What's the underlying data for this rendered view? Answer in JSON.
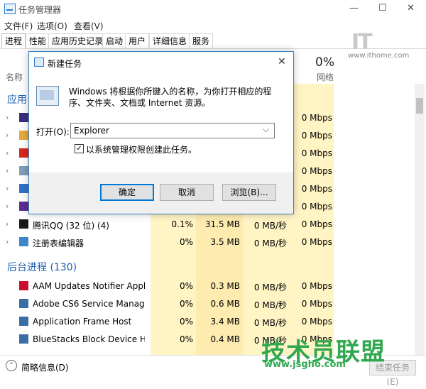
{
  "window": {
    "title": "任务管理器",
    "minimize": "—",
    "maximize": "☐",
    "close": "✕"
  },
  "menu": [
    "文件(F)",
    "选项(O)",
    "查看(V)"
  ],
  "tabs": [
    "进程",
    "性能",
    "应用历史记录",
    "启动",
    "用户",
    "详细信息",
    "服务"
  ],
  "watermark_top": {
    "logo": "IT",
    "site": "www.ithome.com"
  },
  "header": {
    "name_col": "名称",
    "network_pct": "0%",
    "network_label": "网络"
  },
  "groups": {
    "apps": "应用",
    "background": "后台进程 (130)"
  },
  "app_rows": [
    {
      "name": "",
      "cpu": "",
      "mem": "",
      "disk": "",
      "net": "0 Mbps",
      "icon_color": "#3a2f7d"
    },
    {
      "name": "",
      "cpu": "",
      "mem": "",
      "disk": "",
      "net": "0 Mbps",
      "icon_color": "#e8a83a"
    },
    {
      "name": "",
      "cpu": "",
      "mem": "",
      "disk": "",
      "net": "0 Mbps",
      "icon_color": "#d9261c"
    },
    {
      "name": "",
      "cpu": "",
      "mem": "",
      "disk": "",
      "net": "0 Mbps",
      "icon_color": "#7f9db9"
    },
    {
      "name": "",
      "cpu": "",
      "mem": "",
      "disk": "",
      "net": "0 Mbps",
      "icon_color": "#2d73c9"
    },
    {
      "name": "",
      "cpu": "",
      "mem": "",
      "disk": "",
      "net": "0 Mbps",
      "icon_color": "#5b2d91"
    },
    {
      "name": "腾讯QQ (32 位) (4)",
      "cpu": "0.1%",
      "mem": "31.5 MB",
      "disk": "0 MB/秒",
      "net": "0 Mbps",
      "icon_color": "#1a1a1a"
    },
    {
      "name": "注册表编辑器",
      "cpu": "0%",
      "mem": "3.5 MB",
      "disk": "0 MB/秒",
      "net": "0 Mbps",
      "icon_color": "#3e86c9"
    }
  ],
  "bg_rows": [
    {
      "name": "AAM Updates Notifier Appli...",
      "cpu": "0%",
      "mem": "0.3 MB",
      "disk": "0 MB/秒",
      "net": "0 Mbps",
      "icon_color": "#c8102e"
    },
    {
      "name": "Adobe CS6 Service Manager...",
      "cpu": "0%",
      "mem": "0.6 MB",
      "disk": "0 MB/秒",
      "net": "0 Mbps",
      "icon_color": "#3a6ea5"
    },
    {
      "name": "Application Frame Host",
      "cpu": "0%",
      "mem": "3.4 MB",
      "disk": "0 MB/秒",
      "net": "0 Mbps",
      "icon_color": "#3a6ea5"
    },
    {
      "name": "BlueStacks Block Device Hel...",
      "cpu": "0%",
      "mem": "0.4 MB",
      "disk": "0 MB/秒",
      "net": "0 Mbps",
      "icon_color": "#3a6ea5"
    }
  ],
  "footer": {
    "fewer_details": "简略信息(D)",
    "end_task": "结束任务(E)"
  },
  "watermark_bottom": {
    "text": "技术员联盟",
    "site": "www.jsgho.com"
  },
  "dialog": {
    "title": "新建任务",
    "close": "✕",
    "description": "Windows 将根据你所键入的名称，为你打开相应的程序、文件夹、文档或 Internet 资源。",
    "open_label": "打开(O):",
    "open_value": "Explorer",
    "admin_checkbox": "以系统管理权限创建此任务。",
    "ok": "确定",
    "cancel": "取消",
    "browse": "浏览(B)..."
  },
  "colors": {
    "accent": "#1f5fb3",
    "shade_light": "#fff4c4",
    "shade_mid": "#fdebb0",
    "dialog_border": "#3d7fbf"
  }
}
